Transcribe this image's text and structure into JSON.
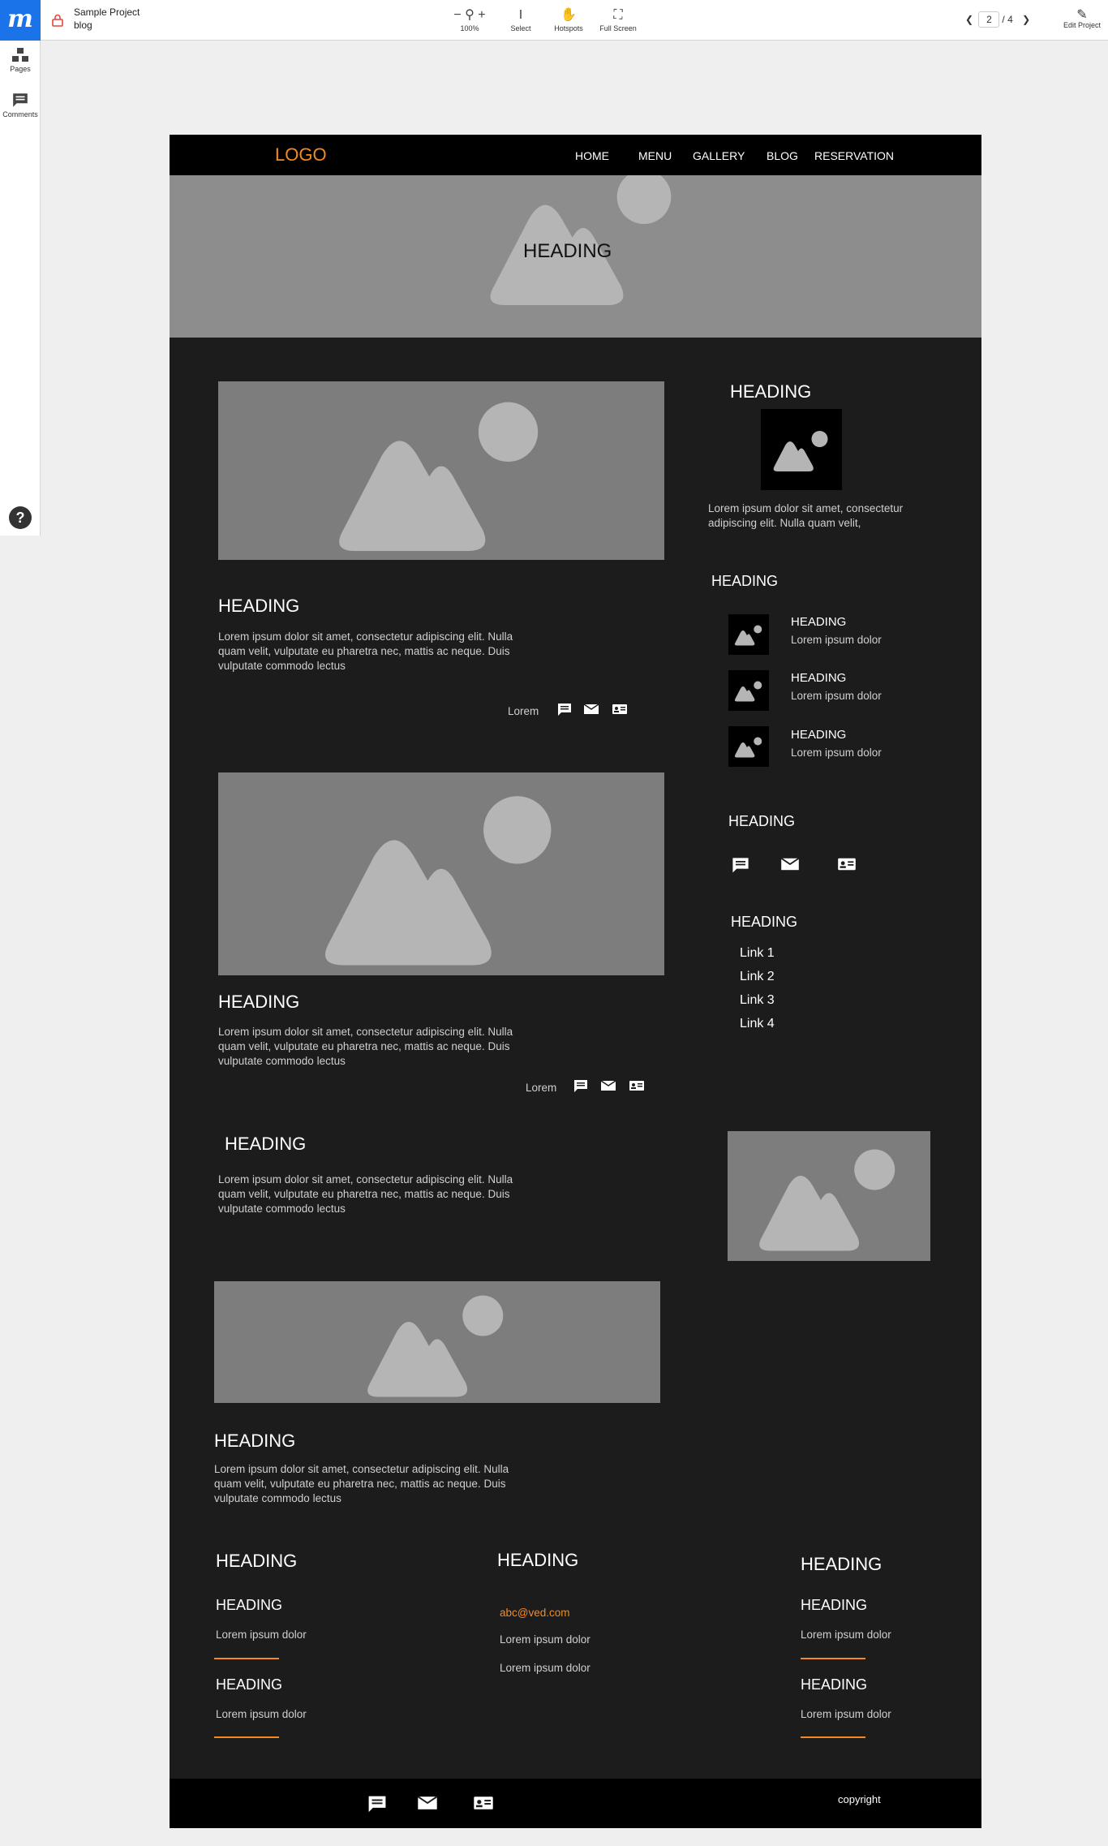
{
  "app": {
    "project_name": "Sample Project",
    "page_name": "blog",
    "toolbar": {
      "zoom_minus": "−",
      "zoom_plus": "+",
      "zoom_label": "100%",
      "select_label": "Select",
      "hotspots_label": "Hotspots",
      "fullscreen_label": "Full Screen"
    },
    "pager": {
      "current": "2",
      "total": "/ 4"
    },
    "edit_label": "Edit Project",
    "sidebar": {
      "pages_label": "Pages",
      "comments_label": "Comments"
    },
    "help_glyph": "?"
  },
  "site": {
    "logo": "LOGO",
    "nav": [
      "HOME",
      "MENU",
      "GALLERY",
      "BLOG",
      "RESERVATION"
    ],
    "hero_heading": "HEADING",
    "posts": [
      {
        "heading": "HEADING",
        "body": "Lorem ipsum dolor sit amet, consectetur adipiscing elit. Nulla quam velit, vulputate eu pharetra nec, mattis ac neque. Duis vulputate commodo lectus",
        "meta": "Lorem"
      },
      {
        "heading": "HEADING",
        "body": "Lorem ipsum dolor sit amet, consectetur adipiscing elit. Nulla quam velit, vulputate eu pharetra nec, mattis ac neque. Duis vulputate commodo lectus",
        "meta": "Lorem"
      },
      {
        "heading": "HEADING",
        "body": "Lorem ipsum dolor sit amet, consectetur adipiscing elit. Nulla quam velit, vulputate eu pharetra nec, mattis ac neque. Duis vulputate commodo lectus"
      },
      {
        "heading": "HEADING",
        "body": "Lorem ipsum dolor sit amet, consectetur adipiscing elit. Nulla quam velit, vulputate eu pharetra nec, mattis ac neque. Duis vulputate commodo lectus"
      }
    ],
    "aside": {
      "about": {
        "heading": "HEADING",
        "body": "Lorem ipsum dolor sit amet, consectetur adipiscing elit. Nulla quam velit,"
      },
      "recent": {
        "heading": "HEADING",
        "items": [
          {
            "title": "HEADING",
            "text": "Lorem ipsum dolor"
          },
          {
            "title": "HEADING",
            "text": "Lorem ipsum dolor"
          },
          {
            "title": "HEADING",
            "text": "Lorem ipsum dolor"
          }
        ]
      },
      "social_heading": "HEADING",
      "links": {
        "heading": "HEADING",
        "items": [
          "Link 1",
          "Link 2",
          "Link 3",
          "Link 4"
        ]
      }
    },
    "footer": {
      "col1": {
        "heading": "HEADING",
        "items": [
          {
            "title": "HEADING",
            "text": "Lorem ipsum dolor"
          },
          {
            "title": "HEADING",
            "text": "Lorem ipsum dolor"
          }
        ]
      },
      "col2": {
        "heading": "HEADING",
        "email": "abc@ved.com",
        "lines": [
          "Lorem ipsum dolor",
          "Lorem ipsum dolor"
        ]
      },
      "col3": {
        "heading": "HEADING",
        "items": [
          {
            "title": "HEADING",
            "text": "Lorem ipsum dolor"
          },
          {
            "title": "HEADING",
            "text": "Lorem ipsum dolor"
          }
        ]
      },
      "copyright": "copyright"
    }
  },
  "colors": {
    "accent": "#f28a22",
    "page_bg": "#1c1c1c",
    "nav_bg": "#000000",
    "hero_bg": "#8d8d8d",
    "placeholder_bg": "#7d7d7d",
    "brand": "#1a73e8"
  },
  "icons": [
    "lock-icon",
    "zoom-icon",
    "select-cursor-icon",
    "hotspot-hand-icon",
    "fullscreen-icon",
    "chevron-left-icon",
    "chevron-right-icon",
    "pencil-icon",
    "pages-icon",
    "comments-icon",
    "help-icon",
    "chat-icon",
    "mail-icon",
    "contact-card-icon",
    "image-placeholder-icon"
  ]
}
